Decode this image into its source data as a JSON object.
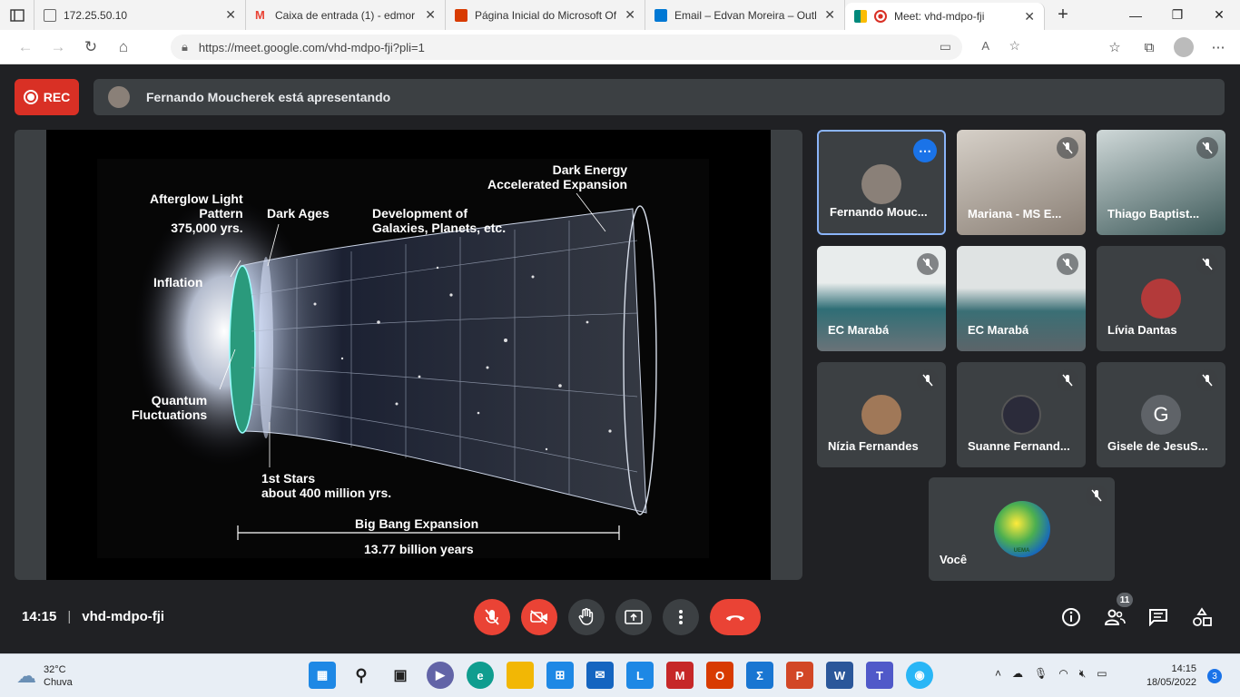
{
  "browser": {
    "tabs": [
      {
        "title": "172.25.50.10",
        "color": "#6b6b6b"
      },
      {
        "title": "Caixa de entrada (1) - edmor",
        "color": "#ea4335"
      },
      {
        "title": "Página Inicial do Microsoft Of",
        "color": "#d83b01"
      },
      {
        "title": "Email – Edvan Moreira – Outl",
        "color": "#0078d4"
      },
      {
        "title": "Meet: vhd-mdpo-fji",
        "color": "#00897b"
      }
    ],
    "url": "https://meet.google.com/vhd-mdpo-fji?pli=1"
  },
  "meet": {
    "rec_label": "REC",
    "presenter_text": "Fernando Moucherek está apresentando",
    "slide": {
      "labels": {
        "afterglow": "Afterglow Light\nPattern\n375,000 yrs.",
        "dark_ages": "Dark Ages",
        "development": "Development of\nGalaxies, Planets, etc.",
        "dark_energy": "Dark Energy\nAccelerated Expansion",
        "inflation": "Inflation",
        "quantum": "Quantum\nFluctuations",
        "first_stars": "1st Stars\nabout 400 million yrs.",
        "big_bang": "Big Bang Expansion",
        "years": "13.77 billion years"
      }
    },
    "participants": [
      {
        "name": "Fernando Mouc...",
        "kind": "avatar",
        "color": "#8a8078"
      },
      {
        "name": "Mariana - MS E...",
        "kind": "video",
        "color": "#9a8f86"
      },
      {
        "name": "Thiago Baptist...",
        "kind": "video",
        "color": "#4c6b6b"
      },
      {
        "name": "EC Marabá",
        "kind": "video",
        "color": "#5b7e8a"
      },
      {
        "name": "EC Marabá",
        "kind": "video",
        "color": "#6f8c93"
      },
      {
        "name": "Lívia Dantas",
        "kind": "avatar",
        "color": "#b33a3a"
      },
      {
        "name": "Nízia Fernandes",
        "kind": "avatar",
        "color": "#a07858"
      },
      {
        "name": "Suanne Fernand...",
        "kind": "avatar",
        "color": "#2b2b3a"
      },
      {
        "name": "Gisele de JesuS...",
        "kind": "letter",
        "color": "#5f6368",
        "letter": "G"
      },
      {
        "name": "Você",
        "kind": "logo",
        "color": "#4caf50",
        "logo_text": "UEMA"
      }
    ],
    "clock": "14:15",
    "meeting_code": "vhd-mdpo-fji",
    "people_count": "11"
  },
  "taskbar": {
    "temperature": "32°C",
    "condition": "Chuva",
    "time": "14:15",
    "date": "18/05/2022",
    "notifications": "3"
  }
}
